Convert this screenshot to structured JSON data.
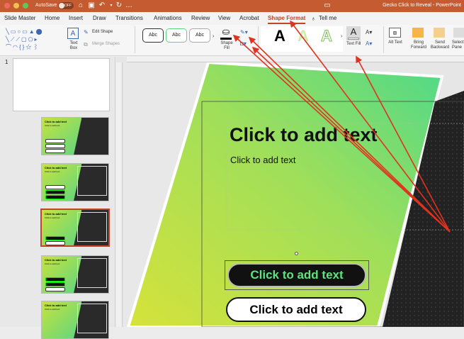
{
  "titlebar": {
    "autosave_label": "AutoSave",
    "autosave_state": "OFF",
    "doc_title": "Gecko Click to Reveal - PowerPoint"
  },
  "tabs": [
    "Slide Master",
    "Home",
    "Insert",
    "Draw",
    "Transitions",
    "Animations",
    "Review",
    "View",
    "Acrobat",
    "Shape Format",
    "Tell me"
  ],
  "active_tab": "Shape Format",
  "ribbon": {
    "text_box": "Text Box",
    "edit_shape": "Edit Shape",
    "merge_shapes": "Merge Shapes",
    "style_labels": [
      "Abc",
      "Abc",
      "Abc"
    ],
    "shape_fill": "Shape Fill",
    "text_fill": "Text Fill",
    "wordart": [
      "A",
      "A",
      "A"
    ],
    "alt_text": "Alt Text",
    "bring_forward": "Bring Forward",
    "send_backward": "Send Backward",
    "selection_pane": "Selection Pane"
  },
  "panel": {
    "slide_number": "1",
    "thumbs": [
      {
        "title": "Click to add text",
        "sub": "Click to add text"
      },
      {
        "title": "Click to add text",
        "sub": "Click to add text"
      },
      {
        "title": "Click to add text",
        "sub": "Click to add text"
      },
      {
        "title": "Click to add text",
        "sub": "Click to add text"
      },
      {
        "title": "Click to add text",
        "sub": "Click to add text"
      }
    ]
  },
  "slide": {
    "title": "Click to add text",
    "subtitle": "Click to add text",
    "button_dark": "Click to add text",
    "button_light": "Click to add text"
  },
  "colors": {
    "titlebar": "#c55c31",
    "accent": "#c1452b",
    "gradient_start": "#c6e33c",
    "gradient_end": "#5ed582",
    "arrow": "#e0321e"
  }
}
